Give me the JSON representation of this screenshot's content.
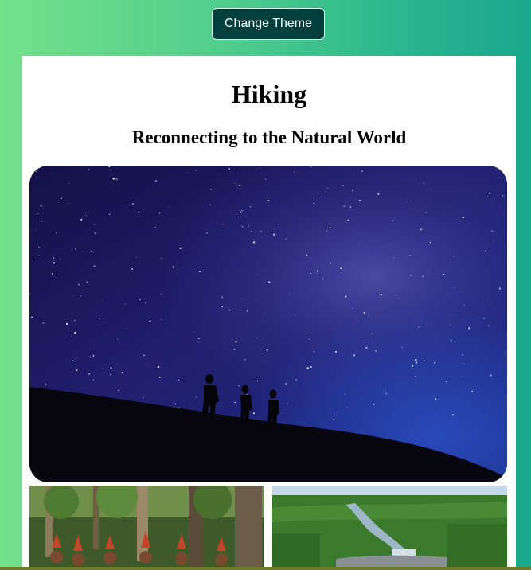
{
  "toolbar": {
    "change_theme_label": "Change Theme"
  },
  "article": {
    "title": "Hiking",
    "subtitle": "Reconnecting to the Natural World"
  },
  "colors": {
    "background_gradient_start": "#74e08c",
    "background_gradient_end": "#1aa88e",
    "button_background": "#033f3d",
    "card_background": "#ffffff"
  },
  "images": {
    "hero": "night-sky-hikers-photo",
    "thumb_left": "forest-tribe-photo",
    "thumb_right": "river-waterfall-aerial-photo"
  }
}
